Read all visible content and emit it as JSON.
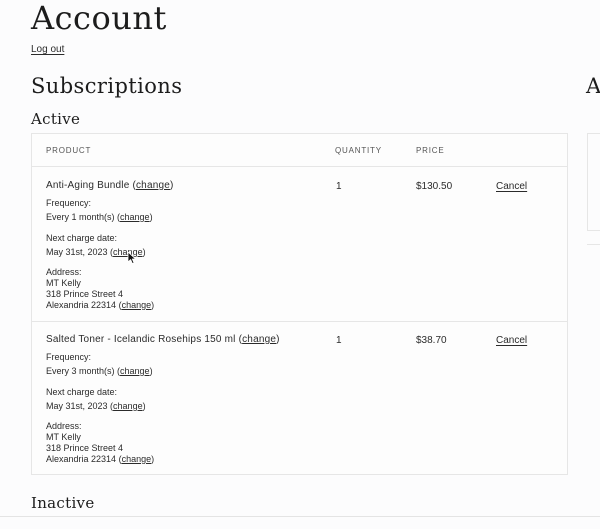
{
  "page": {
    "title": "Account",
    "logout_label": "Log out",
    "subscriptions_title": "Subscriptions",
    "active_title": "Active",
    "inactive_title": "Inactive",
    "right_heading_partial": "A"
  },
  "table": {
    "headers": {
      "product": "PRODUCT",
      "quantity": "QUANTITY",
      "price": "PRICE"
    },
    "rows": [
      {
        "product": "Anti-Aging Bundle",
        "frequency_label": "Frequency:",
        "frequency_value": "Every 1 month(s)",
        "next_charge_label": "Next charge date:",
        "next_charge_value": "May 31st, 2023",
        "address_label": "Address:",
        "address_name": "MT Kelly",
        "address_street": "318 Prince Street 4",
        "address_city": "Alexandria 22314",
        "quantity": "1",
        "price": "$130.50",
        "cancel_label": "Cancel"
      },
      {
        "product": "Salted Toner - Icelandic Rosehips 150 ml",
        "frequency_label": "Frequency:",
        "frequency_value": "Every 3 month(s)",
        "next_charge_label": "Next charge date:",
        "next_charge_value": "May 31st, 2023",
        "address_label": "Address:",
        "address_name": "MT Kelly",
        "address_street": "318 Prince Street 4",
        "address_city": "Alexandria 22314",
        "quantity": "1",
        "price": "$38.70",
        "cancel_label": "Cancel"
      }
    ],
    "change_label": "change"
  }
}
